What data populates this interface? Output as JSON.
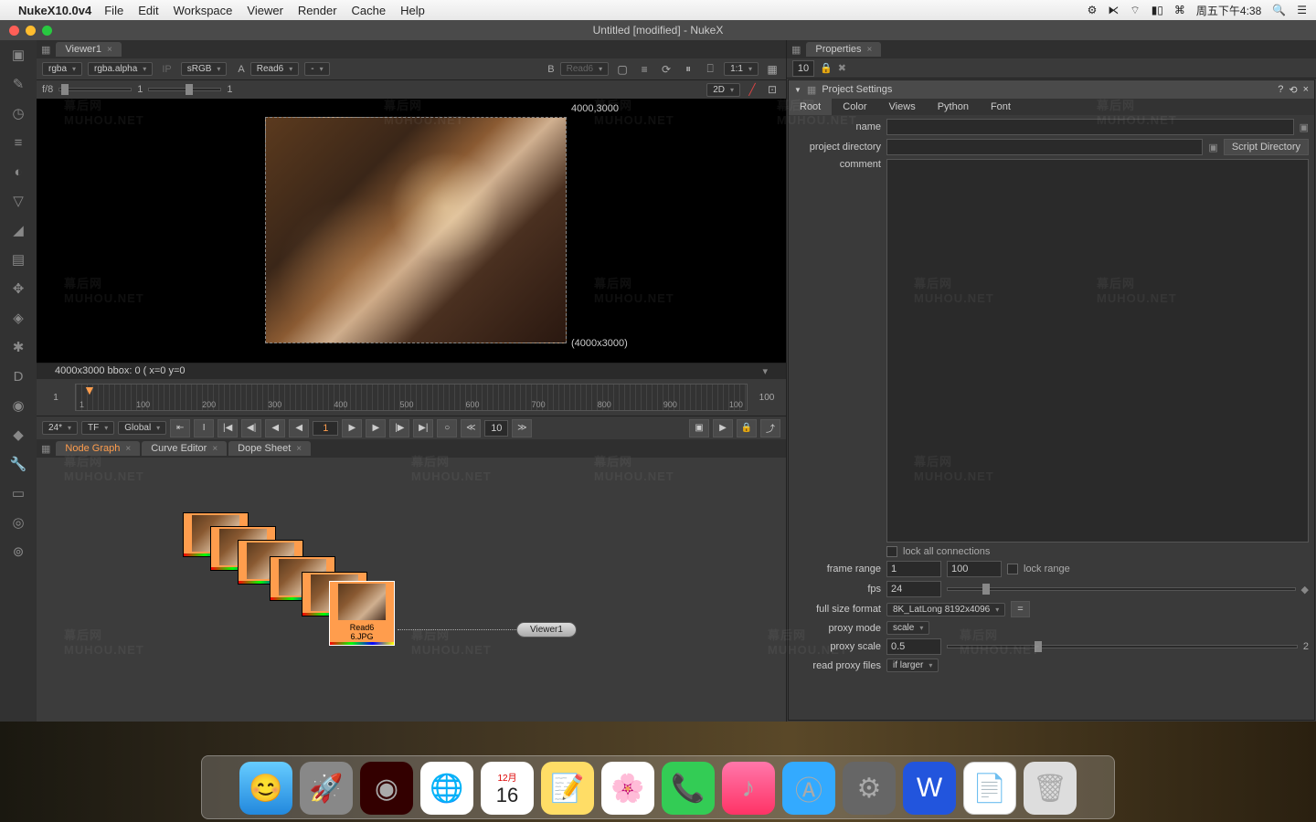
{
  "menubar": {
    "app": "NukeX10.0v4",
    "items": [
      "File",
      "Edit",
      "Workspace",
      "Viewer",
      "Render",
      "Cache",
      "Help"
    ],
    "clock": "周五下午4:38"
  },
  "window": {
    "title": "Untitled [modified] - NukeX"
  },
  "viewer": {
    "tab": "Viewer1",
    "channel1": "rgba",
    "channel2": "rgba.alpha",
    "ip": "IP",
    "colorspace": "sRGB",
    "inputA_label": "A",
    "inputA": "Read6",
    "inputB_label": "B",
    "inputB": "Read6",
    "dash": "-",
    "zoom": "1:1",
    "mode2d": "2D",
    "f8": "f/8",
    "gamma1": "1",
    "gamma2": "1",
    "dim_tr": "4000,3000",
    "dim_br": "(4000x3000)",
    "status": "4000x3000  bbox: 0 (  x=0 y=0"
  },
  "timeline": {
    "start_field": "1",
    "start": "1",
    "end": "100",
    "end_field": "100",
    "fps": "24*",
    "tf": "TF",
    "scope": "Global",
    "frame": "1",
    "jump": "10",
    "ticks": [
      "1",
      "100",
      "200",
      "300",
      "400",
      "500",
      "600",
      "700",
      "800",
      "900",
      "100"
    ]
  },
  "panels": {
    "node_graph": "Node Graph",
    "curve_editor": "Curve Editor",
    "dope_sheet": "Dope Sheet"
  },
  "nodes": {
    "read6": "Read6\n6.JPG",
    "viewer": "Viewer1"
  },
  "properties": {
    "title": "Properties",
    "count": "10",
    "section": "Project Settings",
    "tabs": [
      "Root",
      "Color",
      "Views",
      "Python",
      "Font"
    ],
    "name_label": "name",
    "projdir_label": "project directory",
    "scriptdir_btn": "Script Directory",
    "comment_label": "comment",
    "lock_connections": "lock all connections",
    "frame_range_label": "frame range",
    "frame_start": "1",
    "frame_end": "100",
    "lock_range": "lock range",
    "fps_label": "fps",
    "fps": "24",
    "fullsize_label": "full size format",
    "fullsize": "8K_LatLong 8192x4096",
    "equals": "=",
    "proxymode_label": "proxy mode",
    "proxymode": "scale",
    "proxyscale_label": "proxy scale",
    "proxyscale": "0.5",
    "proxyscale_max": "2",
    "readproxy_label": "read proxy files",
    "readproxy": "if larger"
  },
  "watermark": "MUHOU.NET",
  "watermark_cn": "幕后网"
}
